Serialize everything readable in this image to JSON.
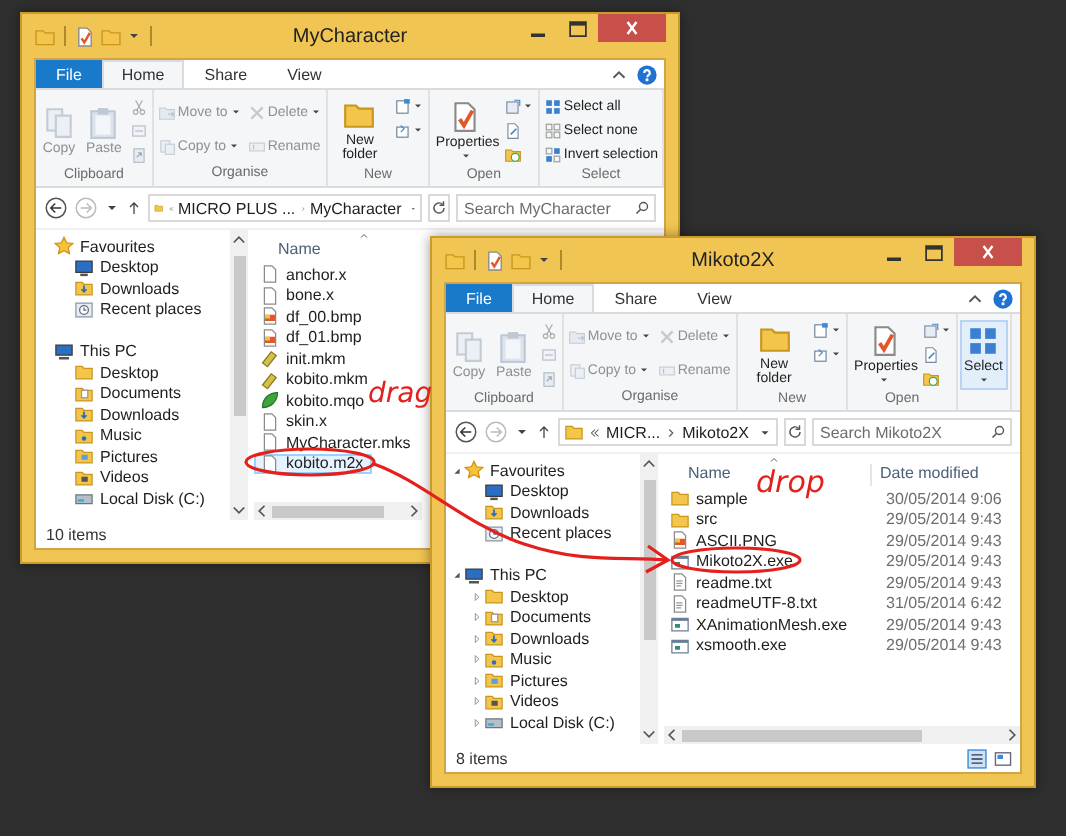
{
  "windows": [
    {
      "title": "MyCharacter",
      "tabs": [
        {
          "label": "File",
          "kind": "menu",
          "selected": false
        },
        {
          "label": "Home",
          "kind": "tab",
          "selected": true
        },
        {
          "label": "Share",
          "kind": "tab",
          "selected": false
        },
        {
          "label": "View",
          "kind": "tab",
          "selected": false
        }
      ],
      "ribbon": [
        {
          "label": "Clipboard",
          "items": [
            {
              "label": "Copy",
              "kind": "copy",
              "disabled": true
            },
            {
              "label": "Paste",
              "kind": "paste",
              "disabled": true
            },
            {
              "kind": "cut",
              "disabled": true
            },
            {
              "kind": "copypath",
              "disabled": true
            },
            {
              "kind": "pasteshortcut",
              "disabled": true
            }
          ]
        },
        {
          "label": "Organise",
          "items": [
            {
              "label": "Move to",
              "kind": "moveto",
              "caret": true,
              "disabled": true
            },
            {
              "label": "Copy to",
              "kind": "copyto",
              "caret": true,
              "disabled": true
            },
            {
              "label": "Delete",
              "kind": "delete",
              "caret": true,
              "disabled": true
            },
            {
              "label": "Rename",
              "kind": "rename",
              "disabled": true
            }
          ]
        },
        {
          "label": "New",
          "items": [
            {
              "label": "New folder",
              "kind": "newfolder"
            },
            {
              "kind": "newitem",
              "caret": true
            },
            {
              "kind": "easyaccess",
              "caret": true
            }
          ]
        },
        {
          "label": "Open",
          "items": [
            {
              "label": "Properties",
              "kind": "properties",
              "caret": true
            },
            {
              "kind": "open",
              "caret": true
            },
            {
              "kind": "edit"
            },
            {
              "kind": "history"
            }
          ]
        },
        {
          "label": "Select",
          "items": [
            {
              "label": "Select all",
              "kind": "selectall"
            },
            {
              "label": "Select none",
              "kind": "selectnone"
            },
            {
              "label": "Invert selection",
              "kind": "invert"
            }
          ]
        }
      ],
      "address": [
        "MICRO PLUS ...",
        "MyCharacter"
      ],
      "search": {
        "placeholder": "Search MyCharacter"
      },
      "nav": [
        {
          "label": "Favourites",
          "kind": "star",
          "children": [
            {
              "label": "Desktop",
              "kind": "desktop"
            },
            {
              "label": "Downloads",
              "kind": "downloads"
            },
            {
              "label": "Recent places",
              "kind": "recent"
            }
          ]
        },
        {
          "label": "This PC",
          "kind": "pc",
          "children": [
            {
              "label": "Desktop",
              "kind": "folder"
            },
            {
              "label": "Documents",
              "kind": "docs"
            },
            {
              "label": "Downloads",
              "kind": "downloads"
            },
            {
              "label": "Music",
              "kind": "music"
            },
            {
              "label": "Pictures",
              "kind": "pictures"
            },
            {
              "label": "Videos",
              "kind": "videos"
            },
            {
              "label": "Local Disk (C:)",
              "kind": "disk"
            }
          ]
        }
      ],
      "columns": [
        "Name"
      ],
      "files": [
        {
          "name": "anchor.x",
          "kind": "file",
          "selected": false
        },
        {
          "name": "bone.x",
          "kind": "file",
          "selected": false
        },
        {
          "name": "df_00.bmp",
          "kind": "image",
          "selected": false
        },
        {
          "name": "df_01.bmp",
          "kind": "image",
          "selected": false
        },
        {
          "name": "init.mkm",
          "kind": "mkm",
          "selected": false
        },
        {
          "name": "kobito.mkm",
          "kind": "mkm",
          "selected": false
        },
        {
          "name": "kobito.mqo",
          "kind": "mqo",
          "selected": false
        },
        {
          "name": "skin.x",
          "kind": "file",
          "selected": false
        },
        {
          "name": "MyCharacter.mks",
          "kind": "file",
          "selected": false
        },
        {
          "name": "kobito.m2x",
          "kind": "file",
          "selected": true
        }
      ],
      "status": "10 items"
    },
    {
      "title": "Mikoto2X",
      "tabs": [
        {
          "label": "File",
          "kind": "menu",
          "selected": false
        },
        {
          "label": "Home",
          "kind": "tab",
          "selected": true
        },
        {
          "label": "Share",
          "kind": "tab",
          "selected": false
        },
        {
          "label": "View",
          "kind": "tab",
          "selected": false
        }
      ],
      "ribbon": [
        {
          "label": "Clipboard",
          "items": [
            {
              "label": "Copy",
              "kind": "copy",
              "disabled": true
            },
            {
              "label": "Paste",
              "kind": "paste",
              "disabled": true
            },
            {
              "kind": "cut",
              "disabled": true
            },
            {
              "kind": "copypath",
              "disabled": true
            },
            {
              "kind": "pasteshortcut",
              "disabled": true
            }
          ]
        },
        {
          "label": "Organise",
          "items": [
            {
              "label": "Move to",
              "kind": "moveto",
              "caret": true,
              "disabled": true
            },
            {
              "label": "Copy to",
              "kind": "copyto",
              "caret": true,
              "disabled": true
            },
            {
              "label": "Delete",
              "kind": "delete",
              "caret": true,
              "disabled": true
            },
            {
              "label": "Rename",
              "kind": "rename",
              "disabled": true
            }
          ]
        },
        {
          "label": "New",
          "items": [
            {
              "label": "New folder",
              "kind": "newfolder"
            },
            {
              "kind": "newitem",
              "caret": true
            },
            {
              "kind": "easyaccess",
              "caret": true
            }
          ]
        },
        {
          "label": "Open",
          "items": [
            {
              "label": "Properties",
              "kind": "properties",
              "caret": true
            },
            {
              "kind": "open",
              "caret": true
            },
            {
              "kind": "edit"
            },
            {
              "kind": "history"
            }
          ]
        },
        {
          "items": [
            {
              "label": "Select",
              "kind": "select",
              "caret": true,
              "highlighted": true
            }
          ]
        }
      ],
      "address": [
        "MICR...",
        "Mikoto2X"
      ],
      "search": {
        "placeholder": "Search Mikoto2X"
      },
      "nav": [
        {
          "label": "Favourites",
          "kind": "star",
          "expanded": true,
          "children": [
            {
              "label": "Desktop",
              "kind": "desktop"
            },
            {
              "label": "Downloads",
              "kind": "downloads"
            },
            {
              "label": "Recent places",
              "kind": "recent"
            }
          ]
        },
        {
          "label": "This PC",
          "kind": "pc",
          "expanded": true,
          "children": [
            {
              "label": "Desktop",
              "kind": "folder",
              "expanded": false
            },
            {
              "label": "Documents",
              "kind": "docs",
              "expanded": false
            },
            {
              "label": "Downloads",
              "kind": "downloads",
              "expanded": false
            },
            {
              "label": "Music",
              "kind": "music",
              "expanded": false
            },
            {
              "label": "Pictures",
              "kind": "pictures",
              "expanded": false
            },
            {
              "label": "Videos",
              "kind": "videos",
              "expanded": false
            },
            {
              "label": "Local Disk (C:)",
              "kind": "disk",
              "expanded": false
            }
          ]
        }
      ],
      "columns": [
        "Name",
        "Date modified"
      ],
      "files": [
        {
          "name": "sample",
          "kind": "folder",
          "date": "30/05/2014 9:06",
          "selected": false
        },
        {
          "name": "src",
          "kind": "folder",
          "date": "29/05/2014 9:43",
          "selected": false
        },
        {
          "name": "ASCII.PNG",
          "kind": "image",
          "date": "29/05/2014 9:43",
          "selected": false
        },
        {
          "name": "Mikoto2X.exe",
          "kind": "exe",
          "date": "29/05/2014 9:43",
          "selected": false
        },
        {
          "name": "readme.txt",
          "kind": "text",
          "date": "29/05/2014 9:43",
          "selected": false
        },
        {
          "name": "readmeUTF-8.txt",
          "kind": "text",
          "date": "31/05/2014 6:42",
          "selected": false
        },
        {
          "name": "XAnimationMesh.exe",
          "kind": "exe",
          "date": "29/05/2014 9:43",
          "selected": false
        },
        {
          "name": "xsmooth.exe",
          "kind": "exe",
          "date": "29/05/2014 9:43",
          "selected": false
        }
      ],
      "status": "8 items"
    }
  ],
  "annotations": {
    "drag_label": "drag",
    "drop_label": "drop"
  }
}
